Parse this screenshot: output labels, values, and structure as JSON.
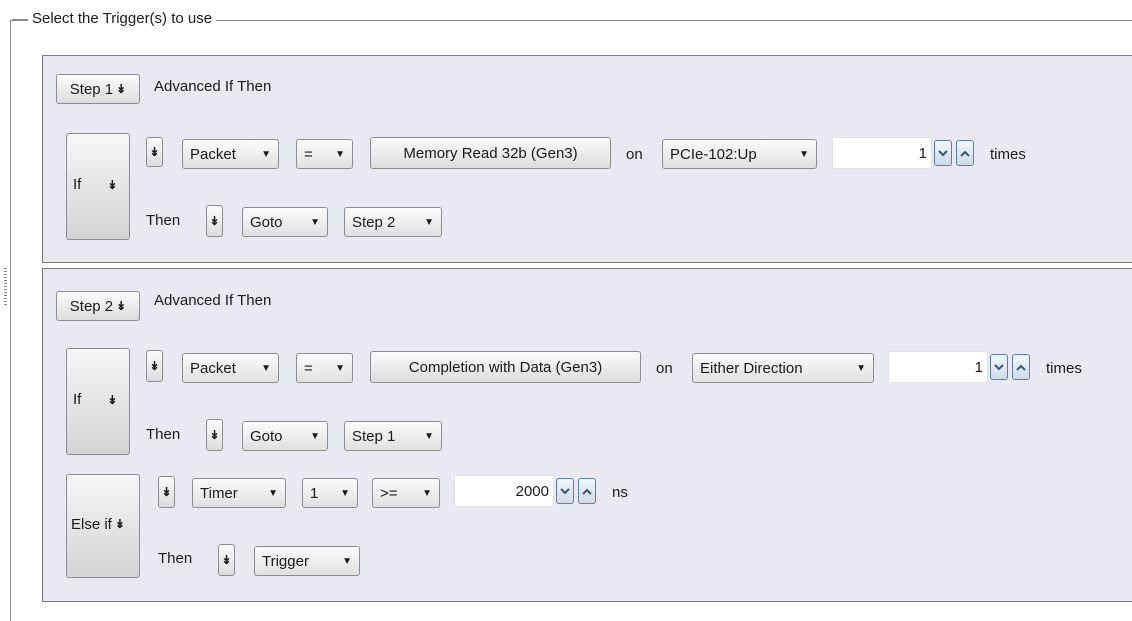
{
  "group": {
    "title": "Select the Trigger(s) to use"
  },
  "steps": [
    {
      "step_label": "Step 1",
      "mode_label": "Advanced If Then",
      "if_label": "If",
      "condition": {
        "field": "Packet",
        "operator": "=",
        "packet_type": "Memory Read 32b (Gen3)",
        "on_label": "on",
        "direction": "PCIe-102:Up",
        "count": "1",
        "times_label": "times"
      },
      "then_label": "Then",
      "action": "Goto",
      "target": "Step 2"
    },
    {
      "step_label": "Step 2",
      "mode_label": "Advanced If Then",
      "if_label": "If",
      "condition": {
        "field": "Packet",
        "operator": "=",
        "packet_type": "Completion with Data (Gen3)",
        "on_label": "on",
        "direction": "Either Direction",
        "count": "1",
        "times_label": "times"
      },
      "then_label": "Then",
      "action": "Goto",
      "target": "Step 1",
      "else_if": {
        "label": "Else if",
        "field": "Timer",
        "timer_index": "1",
        "operator": ">=",
        "value": "2000",
        "unit": "ns",
        "then_label": "Then",
        "action": "Trigger"
      }
    }
  ]
}
